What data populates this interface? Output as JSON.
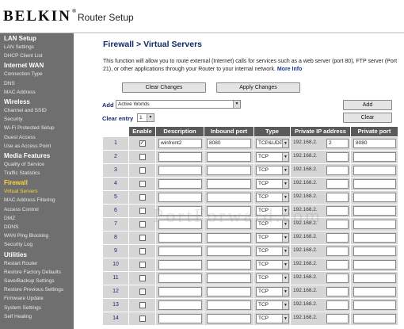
{
  "header": {
    "logo": "BELKIN",
    "logo_mark": "®",
    "title": "Router Setup"
  },
  "sidebar": [
    {
      "label": "LAN Setup",
      "section": true
    },
    {
      "label": "LAN Settings"
    },
    {
      "label": "DHCP Client List"
    },
    {
      "label": "Internet WAN",
      "section": true
    },
    {
      "label": "Connection Type"
    },
    {
      "label": "DNS"
    },
    {
      "label": "MAC Address"
    },
    {
      "label": "Wireless",
      "section": true
    },
    {
      "label": "Channel and SSID"
    },
    {
      "label": "Security"
    },
    {
      "label": "Wi-Fi Protected Setup"
    },
    {
      "label": "Guest Access"
    },
    {
      "label": "Use as Access Point"
    },
    {
      "label": "Media Features",
      "section": true
    },
    {
      "label": "Quality of Service"
    },
    {
      "label": "Traffic Statistics"
    },
    {
      "label": "Firewall",
      "section": true,
      "active": true
    },
    {
      "label": "Virtual Servers",
      "active": true
    },
    {
      "label": "MAC Address Filtering"
    },
    {
      "label": "Access Control"
    },
    {
      "label": "DMZ"
    },
    {
      "label": "DDNS"
    },
    {
      "label": "WAN Ping Blocking"
    },
    {
      "label": "Security Log"
    },
    {
      "label": "Utilities",
      "section": true
    },
    {
      "label": "Restart Router"
    },
    {
      "label": "Restore Factory Defaults"
    },
    {
      "label": "Save/Backup Settings"
    },
    {
      "label": "Restore Previous Settings"
    },
    {
      "label": "Firmware Update"
    },
    {
      "label": "System Settings"
    },
    {
      "label": "Self Healing"
    }
  ],
  "main": {
    "title": "Firewall > Virtual Servers",
    "description": "This function will allow you to route external (Internet) calls for services such as a web server (port 80), FTP server (Port 21), or other applications through your Router to your internal network.",
    "more_info": "More Info",
    "clear_changes": "Clear Changes",
    "apply_changes": "Apply Changes",
    "add_label": "Add",
    "add_value": "Active Worlds",
    "add_button": "Add",
    "clear_entry_label": "Clear entry",
    "clear_entry_value": "1",
    "clear_button": "Clear"
  },
  "table": {
    "headers": [
      "Enable",
      "Description",
      "Inbound port",
      "Type",
      "Private IP address",
      "Private port"
    ],
    "ip_prefix": "192.168.2.",
    "rows": [
      {
        "num": "1",
        "enabled": true,
        "description": "winfront2",
        "inbound": "8080",
        "type": "TCP&UDP",
        "ip": "2",
        "private_port": "8080"
      },
      {
        "num": "2",
        "enabled": false,
        "description": "",
        "inbound": "",
        "type": "TCP",
        "ip": "",
        "private_port": ""
      },
      {
        "num": "3",
        "enabled": false,
        "description": "",
        "inbound": "",
        "type": "TCP",
        "ip": "",
        "private_port": ""
      },
      {
        "num": "4",
        "enabled": false,
        "description": "",
        "inbound": "",
        "type": "TCP",
        "ip": "",
        "private_port": ""
      },
      {
        "num": "5",
        "enabled": false,
        "description": "",
        "inbound": "",
        "type": "TCP",
        "ip": "",
        "private_port": ""
      },
      {
        "num": "6",
        "enabled": false,
        "description": "",
        "inbound": "",
        "type": "TCP",
        "ip": "",
        "private_port": ""
      },
      {
        "num": "7",
        "enabled": false,
        "description": "",
        "inbound": "",
        "type": "TCP",
        "ip": "",
        "private_port": ""
      },
      {
        "num": "8",
        "enabled": false,
        "description": "",
        "inbound": "",
        "type": "TCP",
        "ip": "",
        "private_port": ""
      },
      {
        "num": "9",
        "enabled": false,
        "description": "",
        "inbound": "",
        "type": "TCP",
        "ip": "",
        "private_port": ""
      },
      {
        "num": "10",
        "enabled": false,
        "description": "",
        "inbound": "",
        "type": "TCP",
        "ip": "",
        "private_port": ""
      },
      {
        "num": "11",
        "enabled": false,
        "description": "",
        "inbound": "",
        "type": "TCP",
        "ip": "",
        "private_port": ""
      },
      {
        "num": "12",
        "enabled": false,
        "description": "",
        "inbound": "",
        "type": "TCP",
        "ip": "",
        "private_port": ""
      },
      {
        "num": "13",
        "enabled": false,
        "description": "",
        "inbound": "",
        "type": "TCP",
        "ip": "",
        "private_port": ""
      },
      {
        "num": "14",
        "enabled": false,
        "description": "",
        "inbound": "",
        "type": "TCP",
        "ip": "",
        "private_port": ""
      }
    ]
  },
  "watermark": "PortForward.com"
}
